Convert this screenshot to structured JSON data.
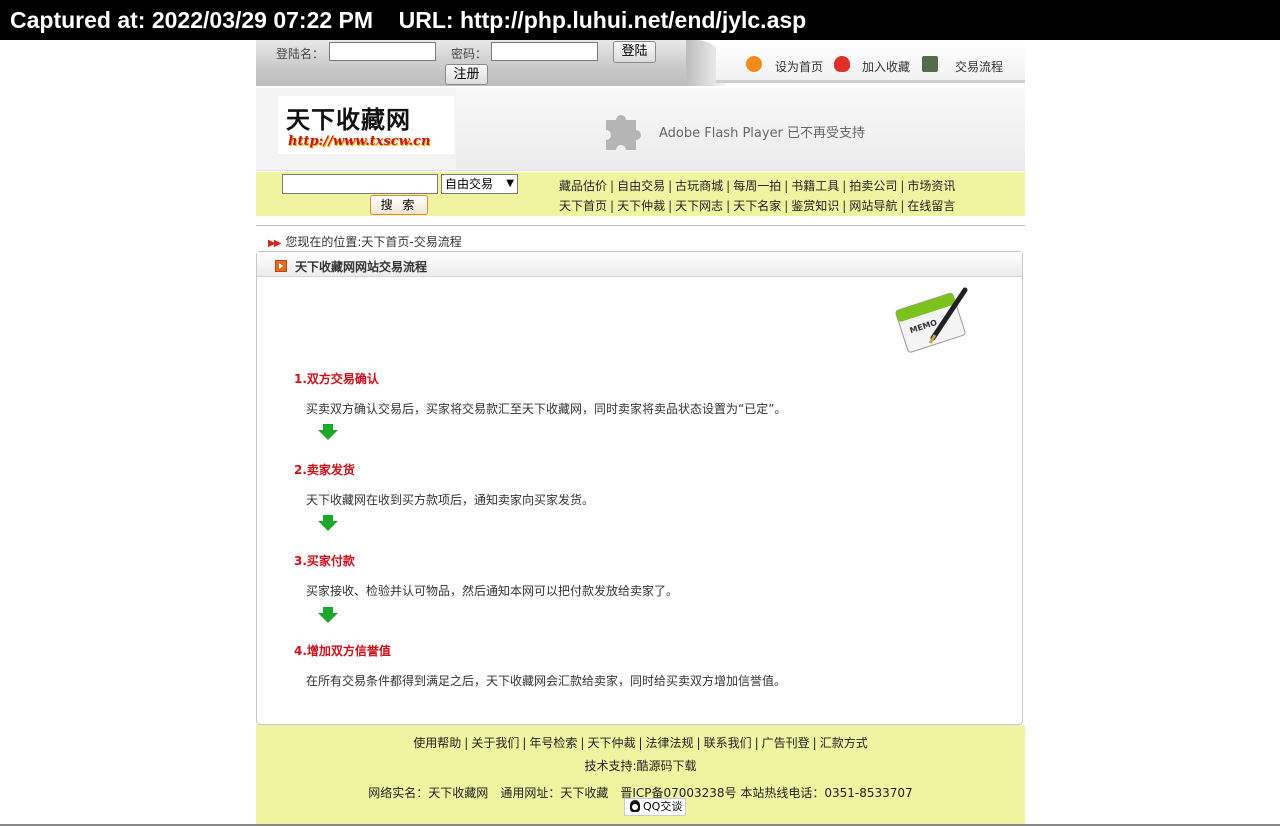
{
  "capture": {
    "text": "Captured at: 2022/03/29 07:22 PM    URL: http://php.luhui.net/end/jylc.asp"
  },
  "login": {
    "username_label": "登陆名：",
    "username_value": "",
    "password_label": "密码：",
    "password_value": "",
    "login_button": "登陆",
    "register_button": "注册"
  },
  "quicklinks": [
    {
      "label": "设为首页",
      "icon": "home-icon"
    },
    {
      "label": "加入收藏",
      "icon": "favorite-icon"
    },
    {
      "label": "交易流程",
      "icon": "flow-icon"
    }
  ],
  "logo": {
    "name": "天下收藏网",
    "url": "http://www.txscw.cn"
  },
  "flash": {
    "message": "Adobe Flash Player 已不再受支持",
    "icon": "puzzle-plugin-icon"
  },
  "search": {
    "value": "",
    "select_value": "自由交易",
    "button_label": "搜 索"
  },
  "nav": {
    "row1": [
      "藏品估价",
      "自由交易",
      "古玩商城",
      "每周一拍",
      "书籍工具",
      "拍卖公司",
      "市场资讯"
    ],
    "row2": [
      "天下首页",
      "天下仲裁",
      "天下网志",
      "天下名家",
      "鉴赏知识",
      "网站导航",
      "在线留言"
    ]
  },
  "location": "您现在的位置:天下首页-交易流程",
  "panel": {
    "title": "天下收藏网网站交易流程",
    "memo_label": "MEMO"
  },
  "steps": [
    {
      "title": "1.双方交易确认",
      "desc": "买卖双方确认交易后，买家将交易款汇至天下收藏网，同时卖家将卖品状态设置为“已定”。"
    },
    {
      "title": "2.卖家发货",
      "desc": "天下收藏网在收到买方款项后，通知卖家向买家发货。"
    },
    {
      "title": "3.买家付款",
      "desc": "买家接收、检验并认可物品，然后通知本网可以把付款发放给卖家了。"
    },
    {
      "title": "4.增加双方信誉值",
      "desc": "在所有交易条件都得到满足之后，天下收藏网会汇款给卖家，同时给买卖双方增加信誉值。"
    }
  ],
  "footer": {
    "links": [
      "使用帮助",
      "关于我们",
      "年号检索",
      "天下仲裁",
      "法律法规",
      "联系我们",
      "广告刊登",
      "汇款方式"
    ],
    "tech_support": "技术支持:酷源码下载",
    "site_name": "网络实名：天下收藏网",
    "general_url": "通用网址：天下收藏",
    "icp_hotline": "晋ICP备07003238号 本站热线电话：0351-8533707",
    "qq_label": "QQ交谈"
  }
}
